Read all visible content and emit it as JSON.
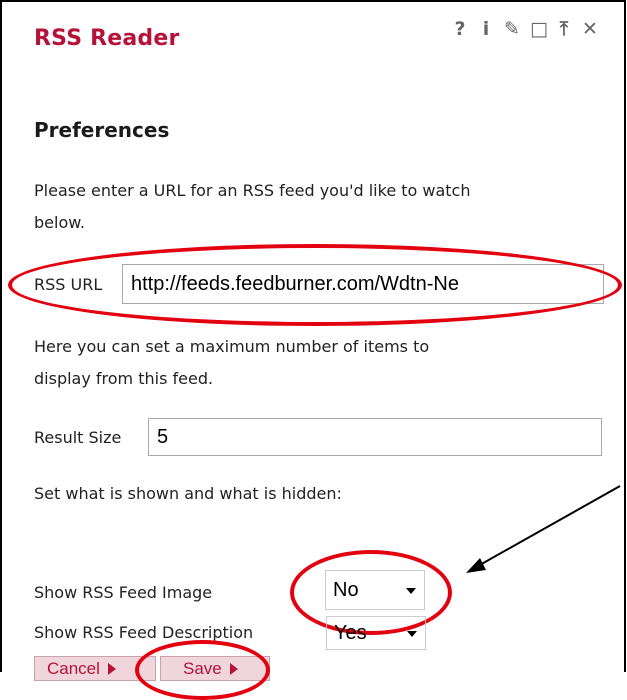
{
  "widget": {
    "title": "RSS Reader",
    "controls": [
      "?",
      "i",
      "✎",
      "□",
      "⤒",
      "✕"
    ]
  },
  "preferences": {
    "heading": "Preferences",
    "url_instructions_line1": "Please enter a URL for an RSS feed you'd like to watch",
    "url_instructions_line2": "below.",
    "rss_url_label": "RSS URL",
    "rss_url_value": "http://feeds.feedburner.com/Wdtn-Ne",
    "size_instructions_line1": "Here you can set a maximum number of items to",
    "size_instructions_line2": "display from this feed.",
    "result_size_label": "Result Size",
    "result_size_value": "5",
    "visibility_instructions": "Set what is shown and what is hidden:",
    "show_image_label": "Show RSS Feed Image",
    "show_image_value": "No",
    "show_description_label": "Show RSS Feed Description",
    "show_description_value": "Yes"
  },
  "buttons": {
    "cancel_label": "Cancel",
    "save_label": "Save"
  },
  "colors": {
    "accent": "#b5123a",
    "annotation": "#e3000f"
  }
}
